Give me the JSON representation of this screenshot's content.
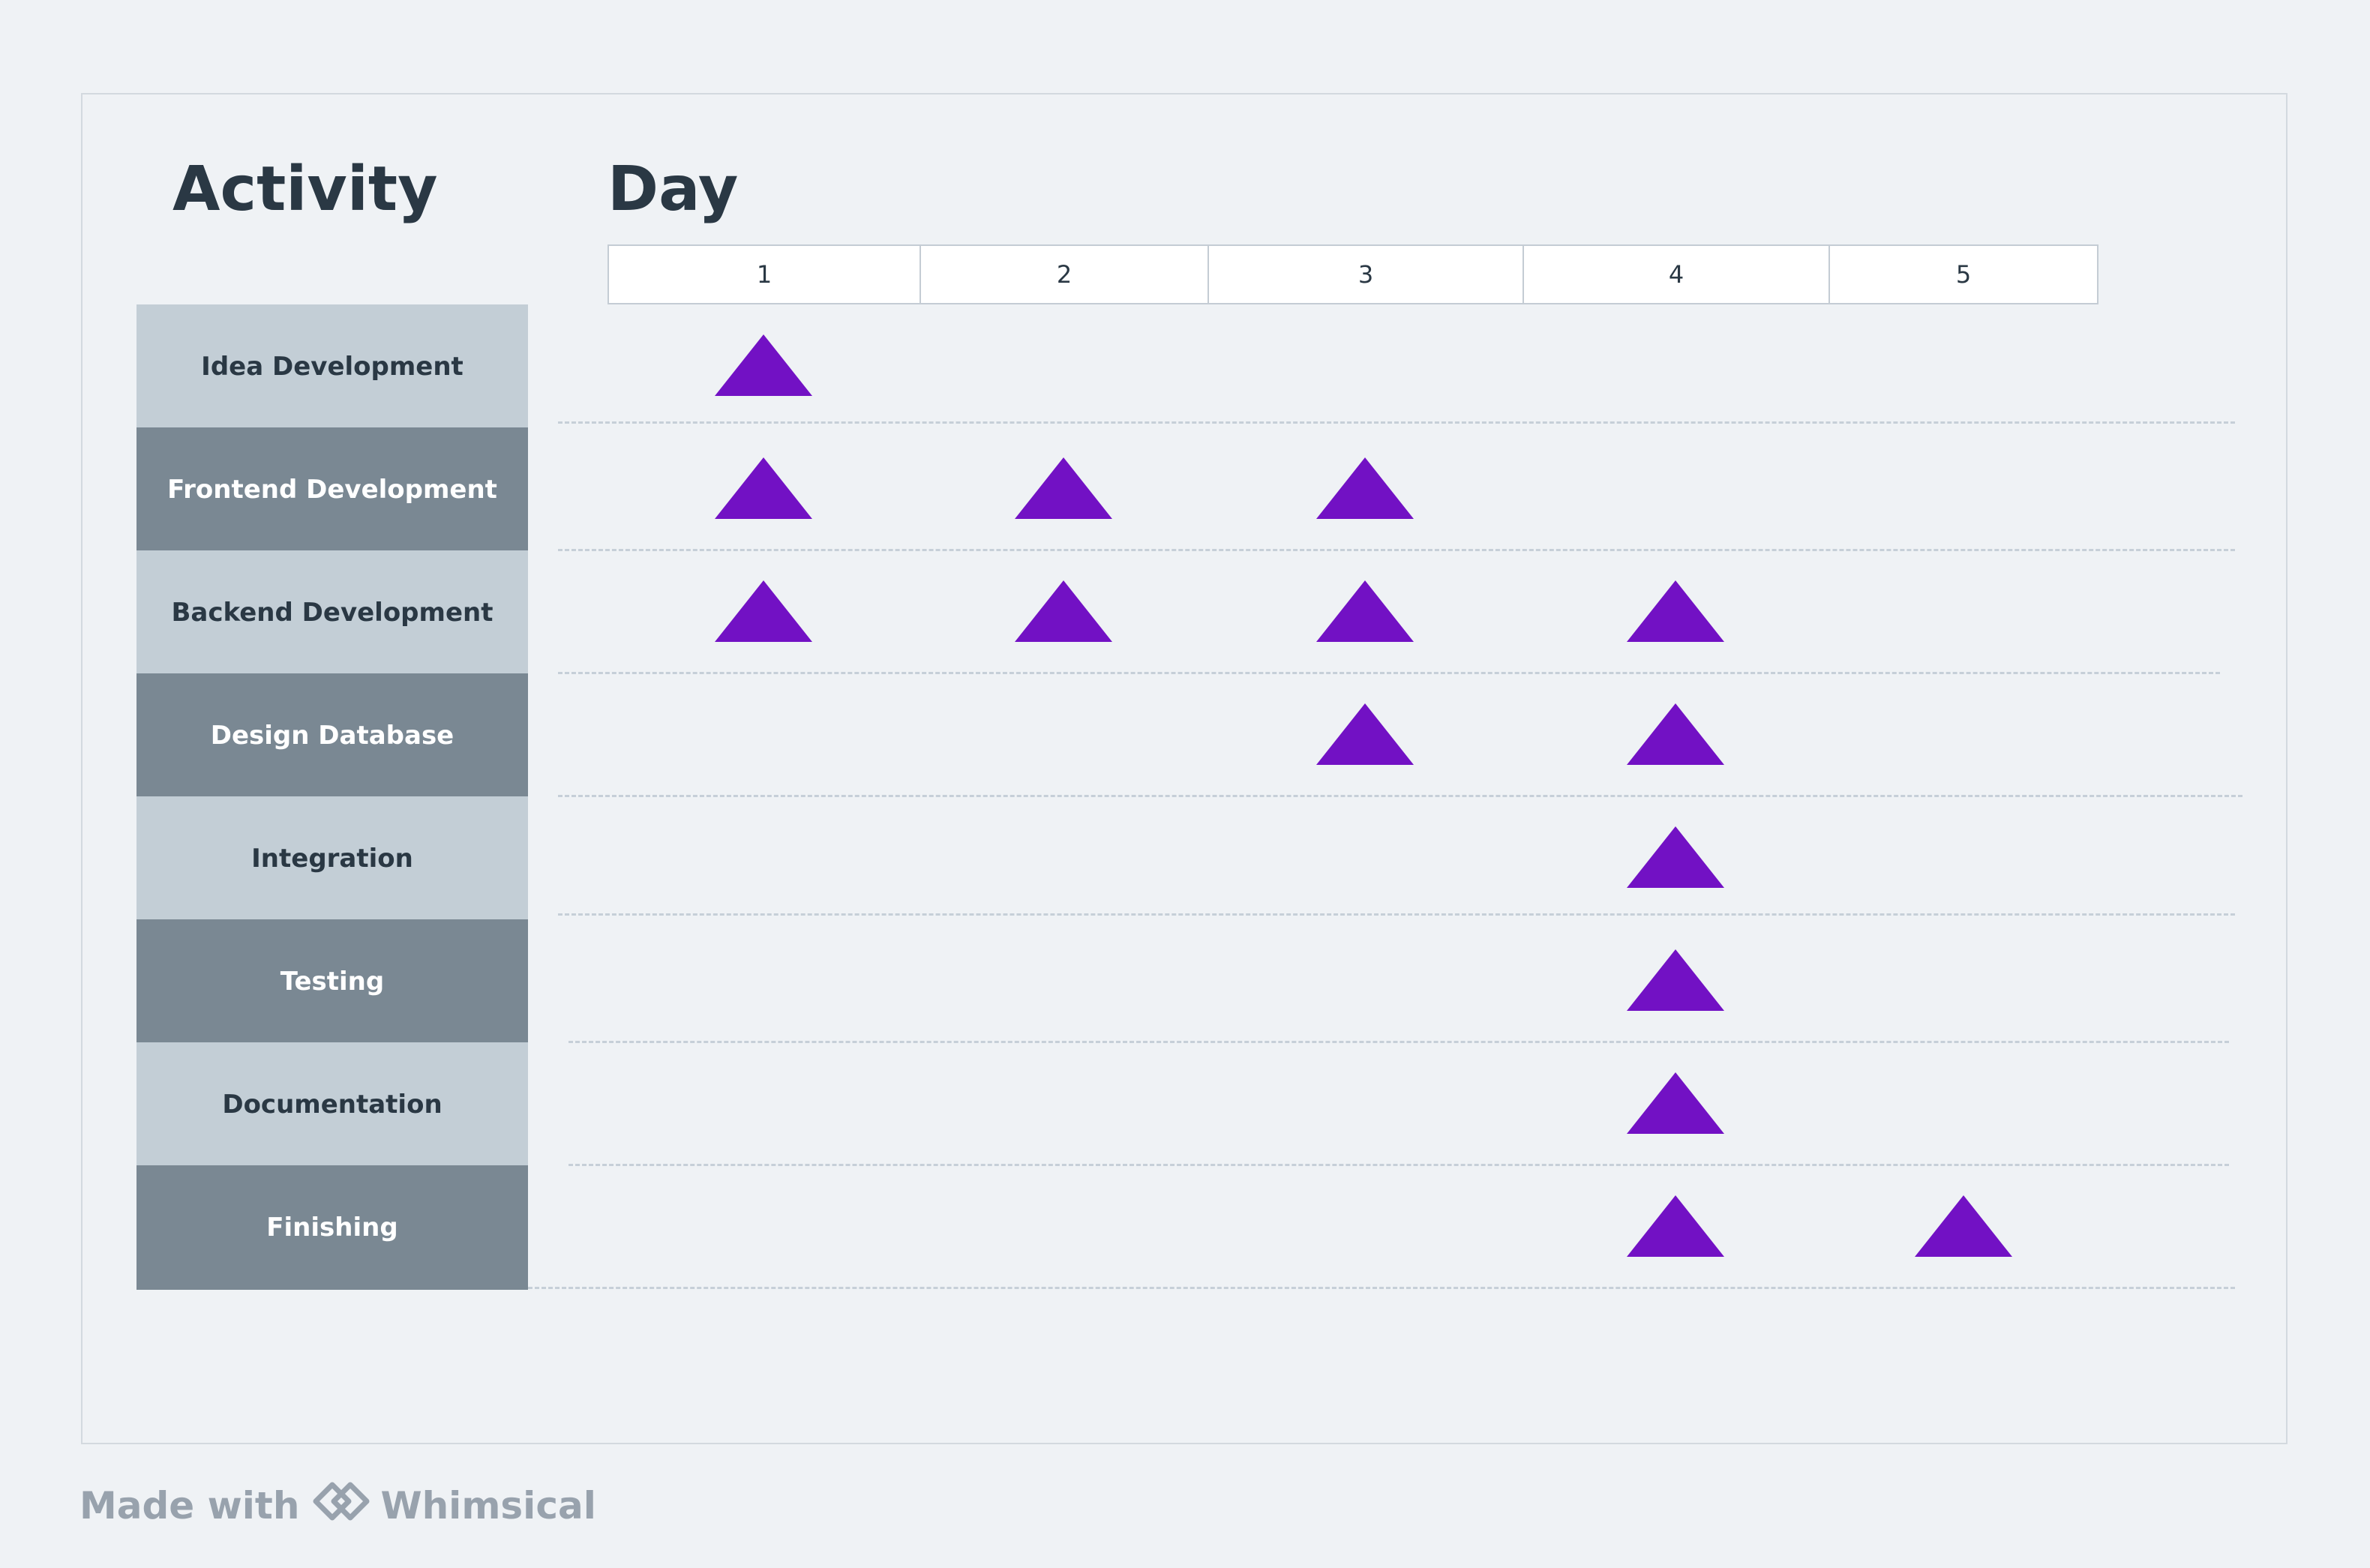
{
  "headers": {
    "activity": "Activity",
    "day": "Day"
  },
  "chart_data": {
    "type": "gantt",
    "days": [
      "1",
      "2",
      "3",
      "4",
      "5"
    ],
    "activities": [
      {
        "label": "Idea Development",
        "days": [
          1
        ]
      },
      {
        "label": "Frontend Development",
        "days": [
          1,
          2,
          3
        ]
      },
      {
        "label": "Backend Development",
        "days": [
          1,
          2,
          3,
          4
        ]
      },
      {
        "label": "Design Database",
        "days": [
          3,
          4
        ]
      },
      {
        "label": "Integration",
        "days": [
          4
        ]
      },
      {
        "label": "Testing",
        "days": [
          4
        ]
      },
      {
        "label": "Documentation",
        "days": [
          4
        ]
      },
      {
        "label": "Finishing",
        "days": [
          4,
          5
        ]
      }
    ],
    "marker_shape": "triangle",
    "marker_color": "#7211c4",
    "row_colors": [
      "#c3ced6",
      "#7a8893"
    ]
  },
  "footer": {
    "made_with": "Made with",
    "brand": "Whimsical"
  }
}
